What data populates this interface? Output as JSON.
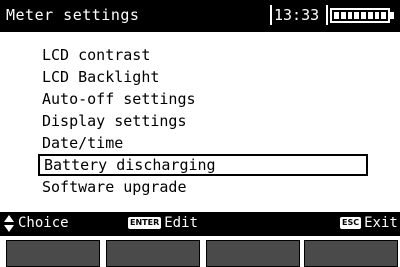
{
  "header": {
    "title": "Meter settings",
    "time": "13:33",
    "battery_icon": "battery-full-icon",
    "battery_level": 1.0
  },
  "menu": {
    "items": [
      {
        "label": "LCD contrast",
        "selected": false
      },
      {
        "label": "LCD Backlight",
        "selected": false
      },
      {
        "label": "Auto-off settings",
        "selected": false
      },
      {
        "label": "Display settings",
        "selected": false
      },
      {
        "label": "Date/time",
        "selected": false
      },
      {
        "label": "Battery discharging",
        "selected": true
      },
      {
        "label": "Software upgrade",
        "selected": false
      }
    ]
  },
  "hints": {
    "choice_icon": "up-down-arrows-icon",
    "choice_label": "Choice",
    "enter_key": "ENTER",
    "enter_label": "Edit",
    "esc_key": "ESC",
    "esc_label": "Exit"
  },
  "colors": {
    "bar_background": "#000000",
    "screen_background": "#ffffff",
    "softkey": "#4a4a4a"
  }
}
